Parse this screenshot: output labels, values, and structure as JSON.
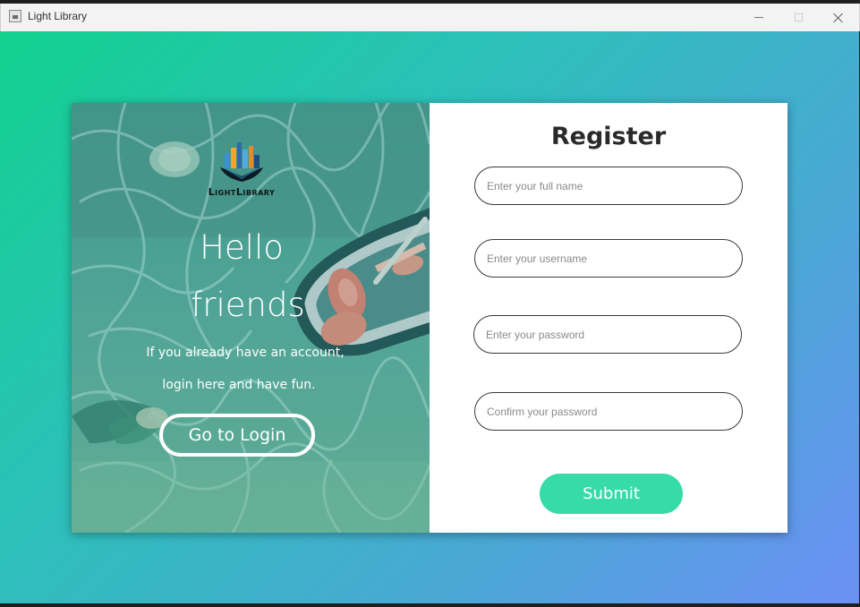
{
  "window": {
    "title": "Light Library",
    "controls": [
      "minimize-icon",
      "maximize-icon",
      "close-icon"
    ]
  },
  "colors": {
    "background_gradient": [
      "#12d18e",
      "#6b8ff5"
    ],
    "accent": "#36dba8",
    "panel_text": "#ffffff"
  },
  "left_panel": {
    "logo_text": "LightLibrary",
    "hello_line1": "Hello",
    "hello_line2": "friends",
    "subtitle_line1": "If you already have an account,",
    "subtitle_line2": "login here and have fun.",
    "login_button": "Go to Login"
  },
  "register": {
    "title": "Register",
    "fields": {
      "full_name": {
        "value": "",
        "placeholder": "Enter your full name"
      },
      "username": {
        "value": "",
        "placeholder": "Enter your username"
      },
      "password": {
        "value": "",
        "placeholder": "Enter your password"
      },
      "confirm_password": {
        "value": "",
        "placeholder": "Confirm your password"
      }
    },
    "submit_button": "Submit"
  }
}
